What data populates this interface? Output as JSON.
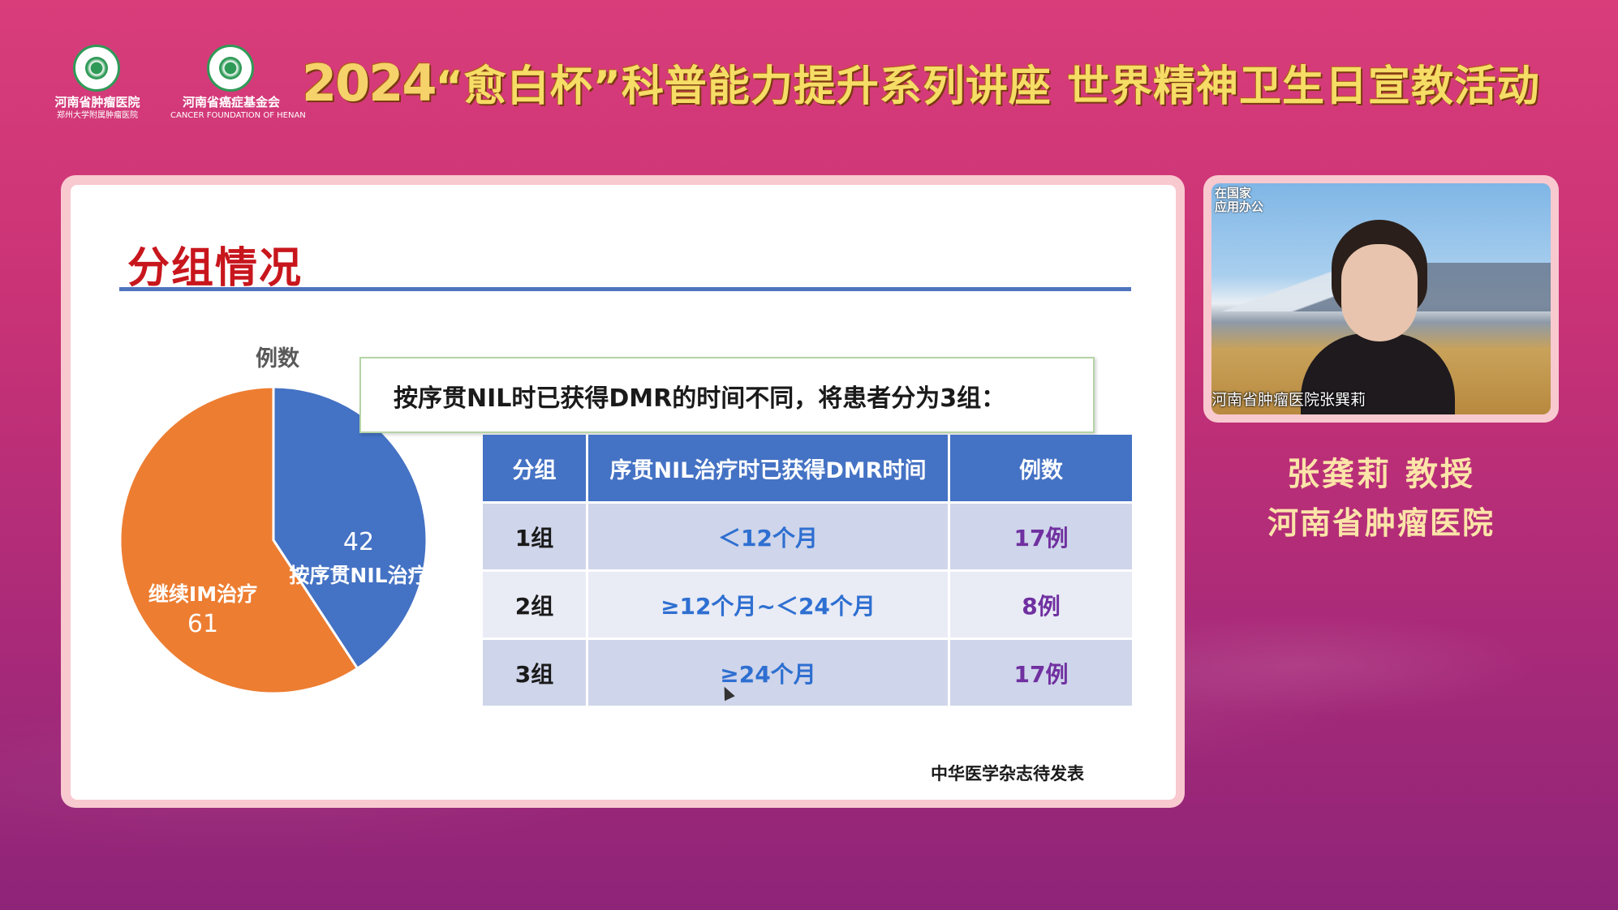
{
  "header": {
    "logo1": {
      "line1": "河南省肿瘤医院",
      "line2": "郑州大学附属肿瘤医院"
    },
    "logo2": {
      "line1": "河南省癌症基金会",
      "line2": "CANCER FOUNDATION OF HENAN"
    },
    "title_year": "2024",
    "title_text": "“愈白杯”科普能力提升系列讲座 世界精神卫生日宣教活动"
  },
  "slide": {
    "title": "分组情况",
    "pie_title": "例数",
    "callout": "按序贯NIL时已获得DMR的时间不同，将患者分为3组：",
    "table": {
      "headers": [
        "分组",
        "序贯NIL治疗时已获得DMR时间",
        "例数"
      ],
      "rows": [
        {
          "group": "1组",
          "time": "＜12个月",
          "count": "17例"
        },
        {
          "group": "2组",
          "time": "≥12个月~＜24个月",
          "count": "8例"
        },
        {
          "group": "3组",
          "time": "≥24个月",
          "count": "17例"
        }
      ]
    },
    "source": "中华医学杂志待发表"
  },
  "chart_data": {
    "type": "pie",
    "title": "例数",
    "categories": [
      "按序贯NIL治疗",
      "继续IM治疗"
    ],
    "values": [
      42,
      61
    ],
    "colors": [
      "#4472c4",
      "#ed7d31"
    ]
  },
  "camera": {
    "sign": "在国家\n应用办公",
    "caption": "河南省肿瘤医院张巽莉"
  },
  "speaker": {
    "name": "张龚莉 教授",
    "org": "河南省肿瘤医院"
  }
}
